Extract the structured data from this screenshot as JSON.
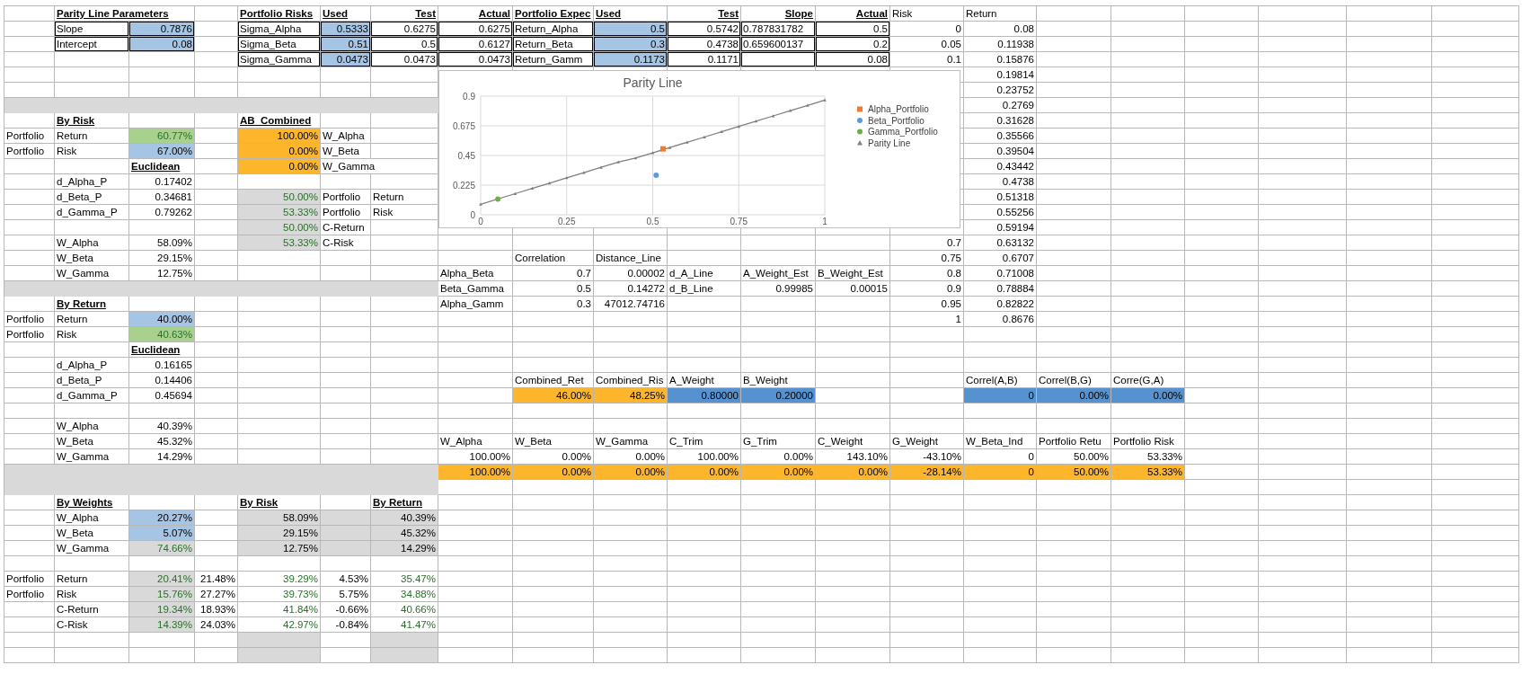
{
  "sheet": {
    "rows": [
      {
        "cells": [
          "",
          {
            "text": "Parity Line Parameters",
            "kind": "heading"
          },
          "",
          "",
          {
            "text": "Portfolio Risks",
            "kind": "heading"
          },
          {
            "text": "Used",
            "kind": "heading"
          },
          {
            "text": "Test",
            "kind": "rheading"
          },
          {
            "text": "Actual",
            "kind": "rheading"
          },
          {
            "text": "Portfolio Expec",
            "kind": "heading"
          },
          {
            "text": "Used",
            "kind": "heading"
          },
          {
            "text": "Test",
            "kind": "rheading"
          },
          {
            "text": "Slope",
            "kind": "rheading"
          },
          {
            "text": "Actual",
            "kind": "rheading"
          },
          "Risk",
          "Return"
        ]
      },
      {
        "cells": [
          "",
          "Slope",
          {
            "text": "0.7876",
            "kind": "input"
          },
          "",
          "Sigma_Alpha",
          {
            "text": "0.5333",
            "kind": "input"
          },
          {
            "text": "0.6275",
            "kind": "number"
          },
          {
            "text": "0.6275",
            "kind": "number"
          },
          "Return_Alpha",
          {
            "text": "0.5",
            "kind": "input"
          },
          {
            "text": "0.5742",
            "kind": "number"
          },
          "0.787831782",
          {
            "text": "0.5",
            "kind": "number"
          },
          {
            "text": "0",
            "kind": "number"
          },
          {
            "text": "0.08",
            "kind": "number"
          }
        ]
      },
      {
        "cells": [
          "",
          "Intercept",
          {
            "text": "0.08",
            "kind": "input"
          },
          "",
          "Sigma_Beta",
          {
            "text": "0.51",
            "kind": "input"
          },
          {
            "text": "0.5",
            "kind": "number"
          },
          {
            "text": "0.6127",
            "kind": "number"
          },
          "Return_Beta",
          {
            "text": "0.3",
            "kind": "input"
          },
          {
            "text": "0.4738",
            "kind": "number"
          },
          "0.659600137",
          {
            "text": "0.2",
            "kind": "number"
          },
          {
            "text": "0.05",
            "kind": "number"
          },
          {
            "text": "0.11938",
            "kind": "number"
          }
        ]
      },
      {
        "cells": [
          "",
          "",
          "",
          "",
          "Sigma_Gamma",
          {
            "text": "0.0473",
            "kind": "input"
          },
          {
            "text": "0.0473",
            "kind": "number"
          },
          {
            "text": "0.0473",
            "kind": "number"
          },
          "Return_Gamm",
          {
            "text": "0.1173",
            "kind": "input"
          },
          {
            "text": "0.1171",
            "kind": "number"
          },
          "",
          {
            "text": "0.08",
            "kind": "number"
          },
          {
            "text": "0.1",
            "kind": "number"
          },
          {
            "text": "0.15876",
            "kind": "number"
          }
        ]
      },
      {
        "cells": [
          "",
          "",
          "",
          "",
          "",
          "",
          "",
          "",
          "",
          "",
          "",
          "",
          "",
          "",
          {
            "text": "0.19814",
            "kind": "number"
          }
        ]
      },
      {
        "cells": [
          "",
          "",
          "",
          "",
          "",
          "",
          "",
          "",
          "",
          "",
          "",
          "",
          "",
          "",
          {
            "text": "0.23752",
            "kind": "number"
          }
        ]
      },
      {
        "band": true,
        "cells": [
          "",
          "",
          "",
          "",
          "",
          "",
          "",
          "",
          "",
          "",
          "",
          "",
          "",
          "",
          {
            "text": "0.2769",
            "kind": "number"
          }
        ]
      },
      {
        "cells": [
          "",
          {
            "text": "By Risk",
            "kind": "heading"
          },
          "",
          "",
          {
            "text": "AB_Combined",
            "kind": "heading"
          },
          "",
          "",
          "",
          "",
          "",
          "",
          "",
          "",
          "",
          {
            "text": "0.31628",
            "kind": "number"
          }
        ]
      },
      {
        "cells": [
          "Portfolio",
          "Return",
          {
            "text": "60.77%",
            "kind": "result"
          },
          "",
          {
            "text": "100.00%",
            "kind": "highlight"
          },
          "W_Alpha",
          "",
          "",
          "",
          "",
          "",
          "",
          "",
          "",
          {
            "text": "0.35566",
            "kind": "number"
          }
        ]
      },
      {
        "cells": [
          "Portfolio",
          "Risk",
          {
            "text": "67.00%",
            "kind": "input"
          },
          "",
          {
            "text": "0.00%",
            "kind": "highlight"
          },
          "W_Beta",
          "",
          "",
          "",
          "",
          "",
          "",
          "",
          "",
          {
            "text": "0.39504",
            "kind": "number"
          }
        ]
      },
      {
        "cells": [
          "",
          "",
          {
            "text": "Euclidean",
            "kind": "heading"
          },
          "",
          {
            "text": "0.00%",
            "kind": "highlight"
          },
          "W_Gamma",
          "",
          "",
          "",
          "",
          "",
          "",
          "",
          "",
          {
            "text": "0.43442",
            "kind": "number"
          }
        ]
      },
      {
        "cells": [
          "",
          "d_Alpha_P",
          {
            "text": "0.17402",
            "kind": "number"
          },
          "",
          "",
          "",
          "",
          "",
          "",
          "",
          "",
          "",
          "",
          "",
          {
            "text": "0.4738",
            "kind": "number"
          }
        ]
      },
      {
        "cells": [
          "",
          "d_Beta_P",
          {
            "text": "0.34681",
            "kind": "number"
          },
          "",
          {
            "text": "50.00%",
            "kind": "formula"
          },
          "Portfolio",
          "Return",
          "",
          "",
          "",
          "",
          "",
          "",
          "",
          {
            "text": "0.51318",
            "kind": "number"
          }
        ]
      },
      {
        "cells": [
          "",
          "d_Gamma_P",
          {
            "text": "0.79262",
            "kind": "number"
          },
          "",
          {
            "text": "53.33%",
            "kind": "formula"
          },
          "Portfolio",
          "Risk",
          "",
          "",
          "",
          "",
          "",
          "",
          "",
          {
            "text": "0.55256",
            "kind": "number"
          }
        ]
      },
      {
        "cells": [
          "",
          "",
          "",
          "",
          {
            "text": "50.00%",
            "kind": "formula"
          },
          "C-Return",
          "",
          "",
          "",
          "",
          "",
          "",
          "",
          "",
          {
            "text": "0.59194",
            "kind": "number"
          }
        ]
      },
      {
        "cells": [
          "",
          "W_Alpha",
          {
            "text": "58.09%",
            "kind": "number"
          },
          "",
          {
            "text": "53.33%",
            "kind": "formula"
          },
          "C-Risk",
          "",
          "",
          "",
          "",
          "",
          "",
          "",
          {
            "text": "0.7",
            "kind": "number"
          },
          {
            "text": "0.63132",
            "kind": "number"
          }
        ]
      },
      {
        "cells": [
          "",
          "W_Beta",
          {
            "text": "29.15%",
            "kind": "number"
          },
          "",
          "",
          "",
          "",
          "",
          "Correlation",
          "Distance_Line",
          "",
          "",
          "",
          {
            "text": "0.75",
            "kind": "number"
          },
          {
            "text": "0.6707",
            "kind": "number"
          }
        ]
      },
      {
        "cells": [
          "",
          "W_Gamma",
          {
            "text": "12.75%",
            "kind": "number"
          },
          "",
          "",
          "",
          "",
          "Alpha_Beta",
          {
            "text": "0.7",
            "kind": "number"
          },
          {
            "text": "0.00002",
            "kind": "number"
          },
          "d_A_Line",
          "A_Weight_Est",
          "B_Weight_Est",
          {
            "text": "0.8",
            "kind": "number"
          },
          {
            "text": "0.71008",
            "kind": "number"
          }
        ]
      },
      {
        "band": true,
        "cells": [
          "",
          "",
          "",
          "",
          "",
          "",
          "",
          "Beta_Gamma",
          {
            "text": "0.5",
            "kind": "number"
          },
          {
            "text": "0.14272",
            "kind": "number"
          },
          "d_B_Line",
          {
            "text": "0.99985",
            "kind": "number"
          },
          {
            "text": "0.00015",
            "kind": "number"
          },
          {
            "text": "0.9",
            "kind": "number"
          },
          {
            "text": "0.78884",
            "kind": "number"
          }
        ]
      },
      {
        "cells": [
          "",
          {
            "text": "By Return",
            "kind": "heading"
          },
          "",
          "",
          "",
          "",
          "",
          "Alpha_Gamm",
          {
            "text": "0.3",
            "kind": "number"
          },
          {
            "text": "47012.74716",
            "kind": "number"
          },
          "",
          "",
          "",
          {
            "text": "0.95",
            "kind": "number"
          },
          {
            "text": "0.82822",
            "kind": "number"
          }
        ]
      },
      {
        "cells": [
          "Portfolio",
          "Return",
          {
            "text": "40.00%",
            "kind": "input"
          },
          "",
          "",
          "",
          "",
          "",
          "",
          "",
          "",
          "",
          "",
          {
            "text": "1",
            "kind": "number"
          },
          {
            "text": "0.8676",
            "kind": "number"
          }
        ]
      },
      {
        "cells": [
          "Portfolio",
          "Risk",
          {
            "text": "40.63%",
            "kind": "result"
          }
        ]
      },
      {
        "cells": [
          "",
          "",
          {
            "text": "Euclidean",
            "kind": "heading"
          }
        ]
      },
      {
        "cells": [
          "",
          "d_Alpha_P",
          {
            "text": "0.16165",
            "kind": "number"
          }
        ]
      },
      {
        "cells": [
          "",
          "d_Beta_P",
          {
            "text": "0.14406",
            "kind": "number"
          },
          "",
          "",
          "",
          "",
          "",
          "Combined_Ret",
          "Combined_Ris",
          "A_Weight",
          "B_Weight",
          "",
          "",
          "Correl(A,B)",
          "Correl(B,G)",
          "Corre(G,A)"
        ]
      },
      {
        "cells": [
          "",
          "d_Gamma_P",
          {
            "text": "0.45694",
            "kind": "number"
          },
          "",
          "",
          "",
          "",
          "",
          {
            "text": "46.00%",
            "kind": "highlight"
          },
          {
            "text": "48.25%",
            "kind": "highlight"
          },
          {
            "text": "0.80000",
            "kind": "key"
          },
          {
            "text": "0.20000",
            "kind": "key"
          },
          "",
          "",
          {
            "text": "0",
            "kind": "key"
          },
          {
            "text": "0.00%",
            "kind": "key"
          },
          {
            "text": "0.00%",
            "kind": "key"
          }
        ]
      },
      {
        "cells": []
      },
      {
        "cells": [
          "",
          "W_Alpha",
          {
            "text": "40.39%",
            "kind": "number"
          }
        ]
      },
      {
        "cells": [
          "",
          "W_Beta",
          {
            "text": "45.32%",
            "kind": "number"
          },
          "",
          "",
          "",
          "",
          "W_Alpha",
          "W_Beta",
          "W_Gamma",
          "C_Trim",
          "G_Trim",
          "C_Weight",
          "G_Weight",
          "W_Beta_Ind",
          "Portfolio Retu",
          "Portfolio Risk"
        ]
      },
      {
        "cells": [
          "",
          "W_Gamma",
          {
            "text": "14.29%",
            "kind": "number"
          },
          "",
          "",
          "",
          "",
          {
            "text": "100.00%",
            "kind": "number"
          },
          {
            "text": "0.00%",
            "kind": "number"
          },
          {
            "text": "0.00%",
            "kind": "number"
          },
          {
            "text": "100.00%",
            "kind": "number"
          },
          {
            "text": "0.00%",
            "kind": "number"
          },
          {
            "text": "143.10%",
            "kind": "number"
          },
          {
            "text": "-43.10%",
            "kind": "number"
          },
          {
            "text": "0",
            "kind": "number"
          },
          {
            "text": "50.00%",
            "kind": "number"
          },
          {
            "text": "53.33%",
            "kind": "number"
          }
        ]
      },
      {
        "band": true,
        "cells": [
          "",
          "",
          "",
          "",
          "",
          "",
          "",
          {
            "text": "100.00%",
            "kind": "highlight"
          },
          {
            "text": "0.00%",
            "kind": "highlight"
          },
          {
            "text": "0.00%",
            "kind": "highlight"
          },
          {
            "text": "0.00%",
            "kind": "highlight"
          },
          {
            "text": "0.00%",
            "kind": "highlight"
          },
          {
            "text": "0.00%",
            "kind": "highlight"
          },
          {
            "text": "-28.14%",
            "kind": "highlight"
          },
          {
            "text": "0",
            "kind": "highlight"
          },
          {
            "text": "50.00%",
            "kind": "highlight"
          },
          {
            "text": "53.33%",
            "kind": "highlight"
          }
        ]
      },
      {
        "band": true,
        "cells": []
      },
      {
        "cells": [
          "",
          {
            "text": "By Weights",
            "kind": "heading"
          },
          "",
          "",
          {
            "text": "By Risk",
            "kind": "heading"
          },
          "",
          {
            "text": "By Return",
            "kind": "heading"
          }
        ]
      },
      {
        "cells": [
          "",
          "W_Alpha",
          {
            "text": "20.27%",
            "kind": "input"
          },
          "",
          {
            "text": "58.09%",
            "kind": "shaded"
          },
          {
            "text": "",
            "kind": "shaded"
          },
          {
            "text": "40.39%",
            "kind": "shaded"
          }
        ]
      },
      {
        "cells": [
          "",
          "W_Beta",
          {
            "text": "5.07%",
            "kind": "input"
          },
          "",
          {
            "text": "29.15%",
            "kind": "shaded"
          },
          {
            "text": "",
            "kind": "shaded"
          },
          {
            "text": "45.32%",
            "kind": "shaded"
          }
        ]
      },
      {
        "cells": [
          "",
          "W_Gamma",
          {
            "text": "74.66%",
            "kind": "formula"
          },
          "",
          {
            "text": "12.75%",
            "kind": "shaded"
          },
          {
            "text": "",
            "kind": "shaded"
          },
          {
            "text": "14.29%",
            "kind": "shaded"
          }
        ]
      },
      {
        "cells": []
      },
      {
        "cells": [
          "Portfolio",
          "Return",
          {
            "text": "20.41%",
            "kind": "formula"
          },
          {
            "text": "21.48%",
            "kind": "number"
          },
          {
            "text": "39.29%",
            "kind": "positive"
          },
          {
            "text": "4.53%",
            "kind": "number"
          },
          {
            "text": "35.47%",
            "kind": "positive"
          }
        ]
      },
      {
        "cells": [
          "Portfolio",
          "Risk",
          {
            "text": "15.76%",
            "kind": "formula"
          },
          {
            "text": "27.27%",
            "kind": "number"
          },
          {
            "text": "39.73%",
            "kind": "positive"
          },
          {
            "text": "5.75%",
            "kind": "number"
          },
          {
            "text": "34.88%",
            "kind": "positive"
          }
        ]
      },
      {
        "cells": [
          "",
          "C-Return",
          {
            "text": "19.34%",
            "kind": "formula"
          },
          {
            "text": "18.93%",
            "kind": "number"
          },
          {
            "text": "41.84%",
            "kind": "positive"
          },
          {
            "text": "-0.66%",
            "kind": "number"
          },
          {
            "text": "40.66%",
            "kind": "positive"
          }
        ]
      },
      {
        "cells": [
          "",
          "C-Risk",
          {
            "text": "14.39%",
            "kind": "formula"
          },
          {
            "text": "24.03%",
            "kind": "number"
          },
          {
            "text": "42.97%",
            "kind": "positive"
          },
          {
            "text": "-0.84%",
            "kind": "number"
          },
          {
            "text": "41.47%",
            "kind": "positive"
          }
        ]
      },
      {
        "cells": [
          "",
          "",
          "",
          "",
          {
            "text": "",
            "kind": "shaded"
          },
          "",
          {
            "text": "",
            "kind": "shaded"
          }
        ]
      },
      {
        "cells": [
          "",
          "",
          "",
          "",
          {
            "text": "",
            "kind": "shaded"
          },
          "",
          {
            "text": "",
            "kind": "shaded"
          }
        ]
      }
    ]
  },
  "chart": {
    "chart_data": {
      "type": "scatter",
      "title": "Parity Line",
      "xlim": [
        0,
        1
      ],
      "ylim": [
        0,
        0.9
      ],
      "xticks": [
        0,
        0.25,
        0.5,
        0.75,
        1
      ],
      "yticks": [
        0,
        0.225,
        0.45,
        0.675,
        0.9
      ],
      "grid": true,
      "legend": true,
      "series": [
        {
          "name": "Alpha_Portfolio",
          "color": "#ed7d31",
          "marker": "square",
          "x": [
            0.53
          ],
          "values": [
            0.5
          ]
        },
        {
          "name": "Beta_Portfolio",
          "color": "#5b9bd5",
          "marker": "circle",
          "x": [
            0.51
          ],
          "values": [
            0.3
          ]
        },
        {
          "name": "Gamma_Portfolio",
          "color": "#70ad47",
          "marker": "circle",
          "x": [
            0.05
          ],
          "values": [
            0.12
          ]
        },
        {
          "name": "Parity Line",
          "type": "line",
          "color": "#7f7f7f",
          "marker": "triangle",
          "x": [
            0,
            0.05,
            0.1,
            0.15,
            0.2,
            0.25,
            0.3,
            0.35,
            0.4,
            0.45,
            0.5,
            0.55,
            0.6,
            0.65,
            0.7,
            0.75,
            0.8,
            0.85,
            0.9,
            0.95,
            1
          ],
          "values": [
            0.08,
            null,
            0.16,
            0.2,
            0.24,
            0.28,
            0.32,
            0.36,
            0.4,
            0.43,
            0.47,
            0.51,
            0.55,
            0.59,
            0.63,
            0.67,
            0.71,
            0.75,
            0.79,
            0.83,
            0.87
          ]
        }
      ]
    }
  }
}
